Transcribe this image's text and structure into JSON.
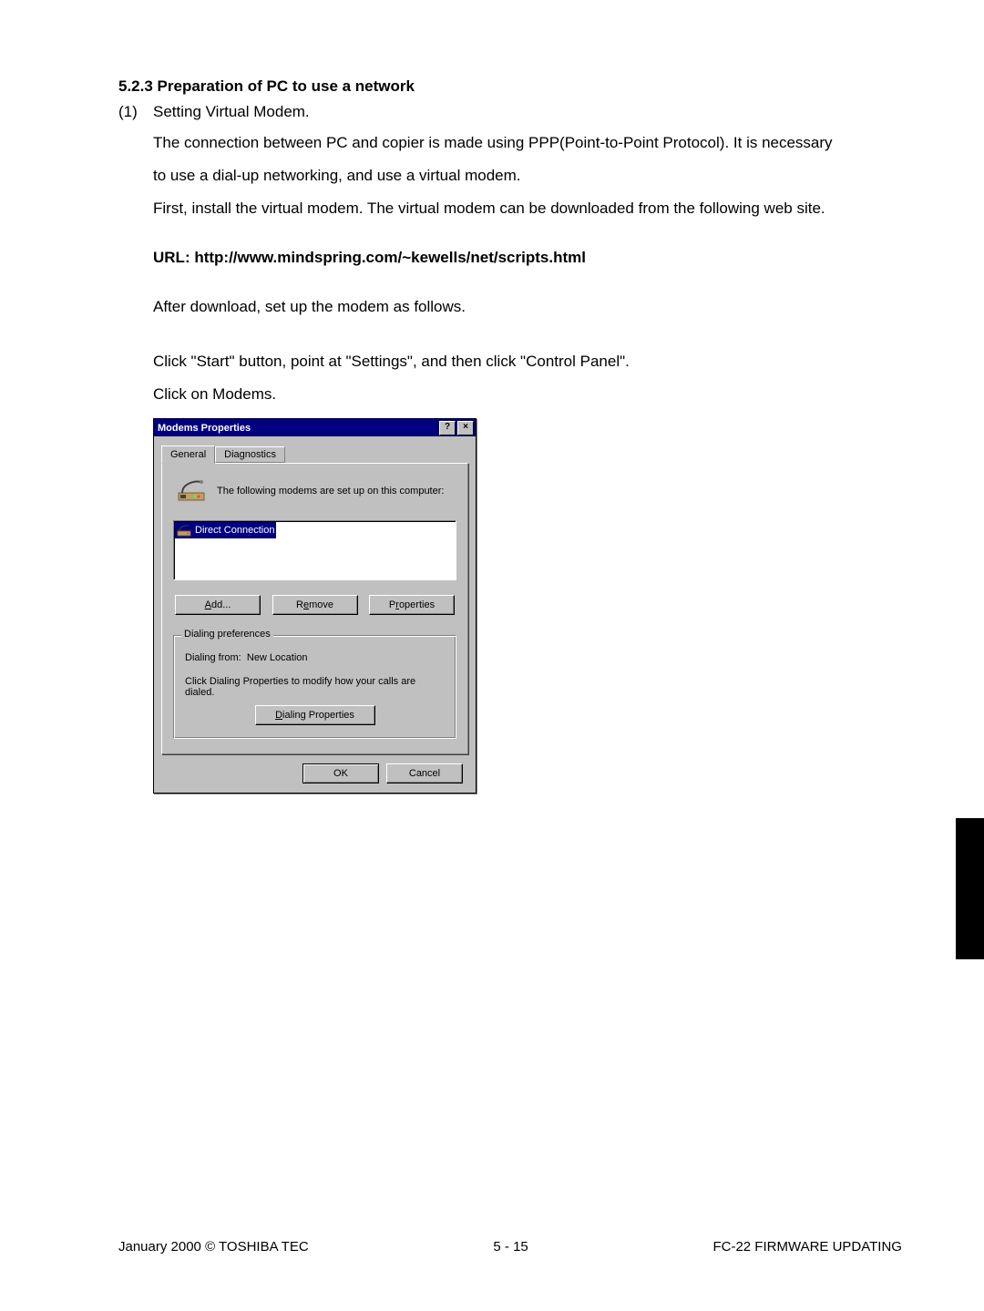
{
  "section_heading": "5.2.3 Preparation of PC to use a network",
  "list": {
    "num": "(1)",
    "title": "Setting Virtual Modem."
  },
  "para1a": "The connection between PC and copier is made using PPP(Point-to-Point Protocol). It is necessary",
  "para1b": "to use a dial-up networking, and use a virtual modem.",
  "para2": "First, install the virtual modem. The virtual modem can be downloaded from the following web site.",
  "url_line": "URL: http://www.mindspring.com/~kewells/net/scripts.html",
  "para3": "After download, set up the modem as follows.",
  "para4": "Click \"Start\" button, point at \"Settings\", and then click \"Control Panel\".",
  "para5": "Click on Modems.",
  "dialog": {
    "title": "Modems Properties",
    "help_btn": "?",
    "close_btn": "×",
    "tabs": {
      "general": "General",
      "diagnostics": "Diagnostics"
    },
    "intro": "The following modems are set up on this computer:",
    "selected_item": "Direct Connection",
    "buttons": {
      "add_pre": "A",
      "add_rest": "dd...",
      "remove_pre": "R",
      "remove_mid": "e",
      "remove_rest": "move",
      "props_pre": "P",
      "props_mid": "r",
      "props_rest": "operties"
    },
    "group": {
      "title": "Dialing preferences",
      "from_label": "Dialing from:",
      "from_value": "New Location",
      "hint": "Click Dialing Properties to modify how your calls are dialed.",
      "dp_pre": "D",
      "dp_rest": "ialing Properties"
    },
    "ok": "OK",
    "cancel": "Cancel"
  },
  "footer": {
    "left": "January 2000  ©  TOSHIBA TEC",
    "center": "5 - 15",
    "right": "FC-22  FIRMWARE UPDATING"
  }
}
